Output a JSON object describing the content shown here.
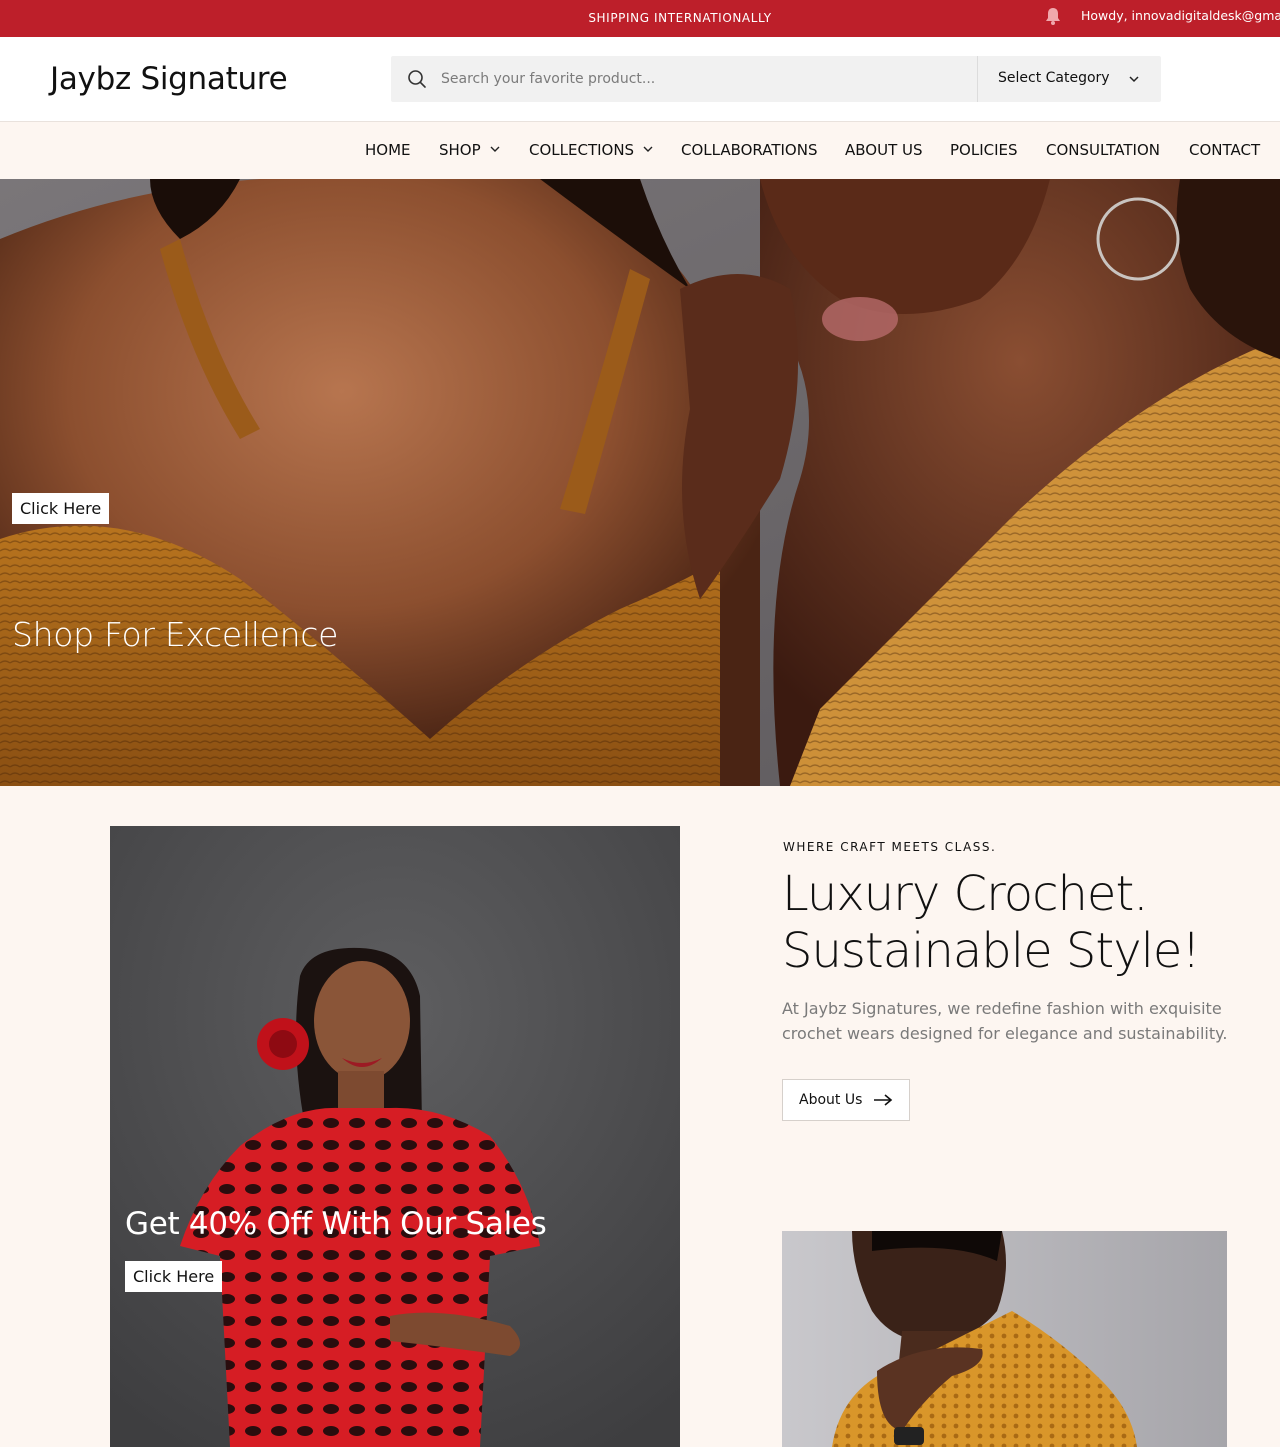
{
  "topbar": {
    "announcement": "SHIPPING INTERNATIONALLY",
    "greeting": "Howdy, innovadigitaldesk@gmail.com",
    "bell_icon": "bell-icon",
    "bg_color": "#bd1f2a"
  },
  "header": {
    "logo": "Jaybz Signature",
    "search_placeholder": "Search your favorite product...",
    "category_label": "Select Category",
    "search_icon": "search-icon"
  },
  "nav": {
    "items": [
      {
        "label": "HOME"
      },
      {
        "label": "SHOP"
      },
      {
        "label": "COLLECTIONS"
      },
      {
        "label": "COLLABORATIONS"
      },
      {
        "label": "ABOUT US"
      },
      {
        "label": "POLICIES"
      },
      {
        "label": "CONSULTATION"
      },
      {
        "label": "CONTACT"
      }
    ]
  },
  "hero": {
    "title": "Shop For Excellence",
    "button": "Click Here"
  },
  "promo": {
    "title": "Get 40% Off With Our Sales",
    "button": "Click Here"
  },
  "intro": {
    "eyebrow": "WHERE CRAFT MEETS CLASS.",
    "headline_line1": "Luxury Crochet.",
    "headline_line2": "Sustainable Style!",
    "description": "At Jaybz Signatures, we redefine fashion with exquisite crochet wears designed for elegance and sustainability.",
    "button": "About Us"
  }
}
